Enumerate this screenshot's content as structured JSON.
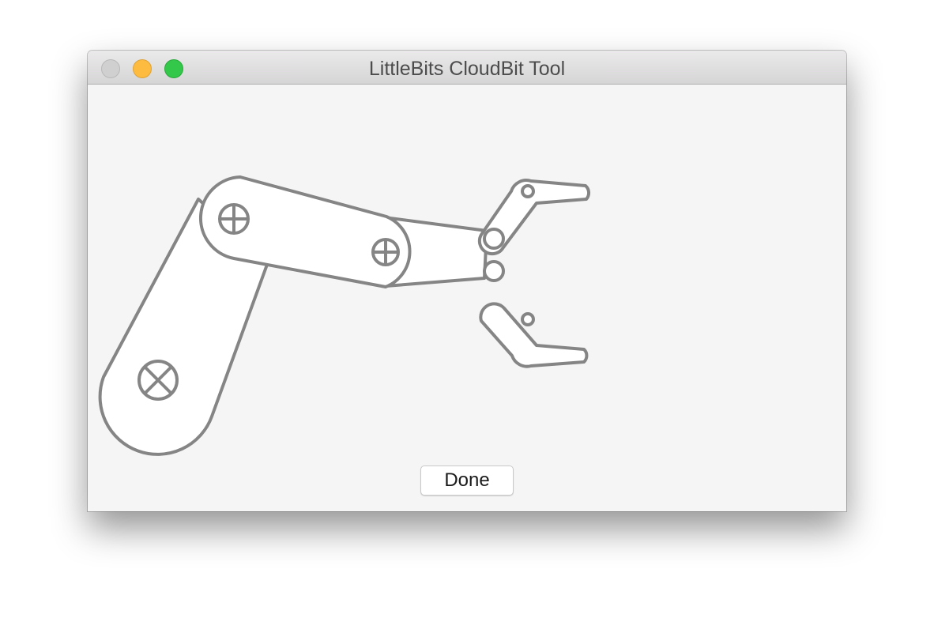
{
  "window": {
    "title": "LittleBits CloudBit Tool"
  },
  "titlebar": {
    "buttons": [
      {
        "name": "close",
        "color": "#d1d0d1"
      },
      {
        "name": "minimize",
        "color": "#fdbc40"
      },
      {
        "name": "zoom",
        "color": "#34c84a"
      }
    ]
  },
  "content": {
    "graphic": "robot-arm-icon",
    "stroke_color": "#858585",
    "fill_color": "#ffffff",
    "done_label": "Done"
  }
}
